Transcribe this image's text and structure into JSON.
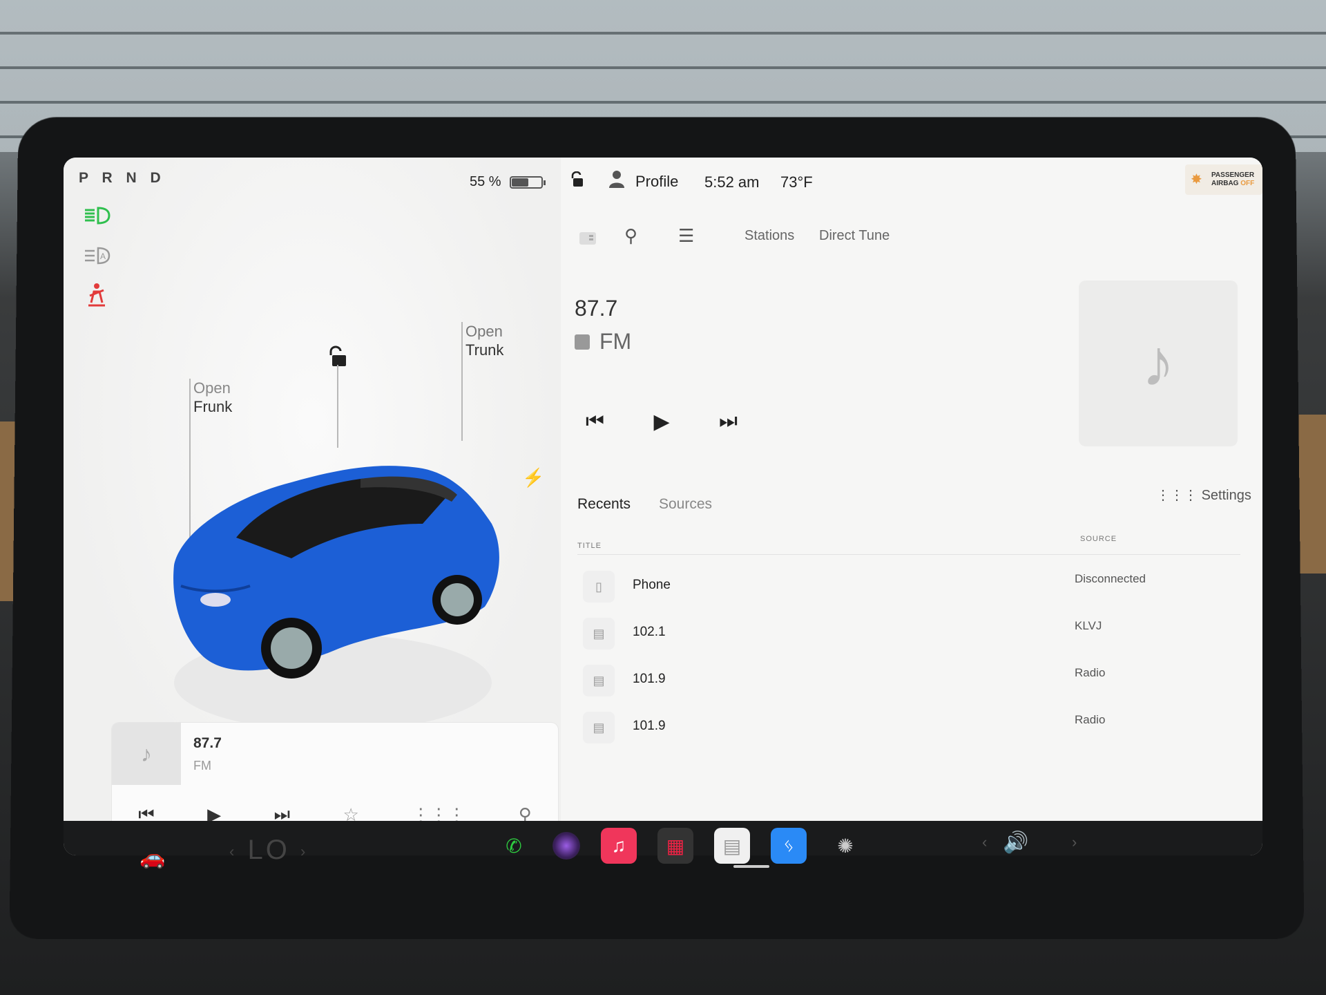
{
  "left": {
    "gear": "P R N D",
    "battery_percent": "55 %",
    "battery_level": 0.55,
    "frunk": {
      "action": "Open",
      "label": "Frunk"
    },
    "trunk": {
      "action": "Open",
      "label": "Trunk"
    },
    "indicators": [
      "headlights-icon",
      "auto-highbeam-icon",
      "seatbelt-icon"
    ],
    "mini_player": {
      "frequency": "87.7",
      "band": "FM",
      "controls": [
        "previous-icon",
        "play-icon",
        "next-icon",
        "favorite-icon",
        "equalizer-icon",
        "search-icon"
      ]
    }
  },
  "status_bar": {
    "profile": "Profile",
    "time": "5:52 am",
    "temperature": "73°F",
    "airbag_line1": "PASSENGER",
    "airbag_line2": "AIRBAG",
    "airbag_state": "OFF"
  },
  "media": {
    "tabs": [
      "Stations",
      "Direct Tune"
    ],
    "now_playing": {
      "frequency": "87.7",
      "band": "FM"
    },
    "list_tabs": {
      "recents": "Recents",
      "sources": "Sources"
    },
    "settings_label": "Settings",
    "columns": {
      "title": "TITLE",
      "source": "SOURCE"
    },
    "rows": [
      {
        "title": "Phone",
        "source": "Disconnected",
        "icon": "phone-icon"
      },
      {
        "title": "102.1",
        "source": "KLVJ",
        "icon": "radio-icon"
      },
      {
        "title": "101.9",
        "source": "Radio",
        "icon": "radio-icon"
      },
      {
        "title": "101.9",
        "source": "Radio",
        "icon": "radio-icon"
      }
    ]
  },
  "dock": {
    "temp_display": "LO",
    "apps": [
      "phone-icon",
      "camera-icon",
      "music-icon",
      "toybox-icon",
      "radio-icon",
      "bluetooth-icon",
      "fan-icon"
    ]
  },
  "colors": {
    "indicator_green": "#2fbf4e",
    "indicator_red": "#e23b3b",
    "car_blue": "#1c5fd6",
    "music_app": "#f0365b",
    "bluetooth_app": "#2a8af6"
  }
}
